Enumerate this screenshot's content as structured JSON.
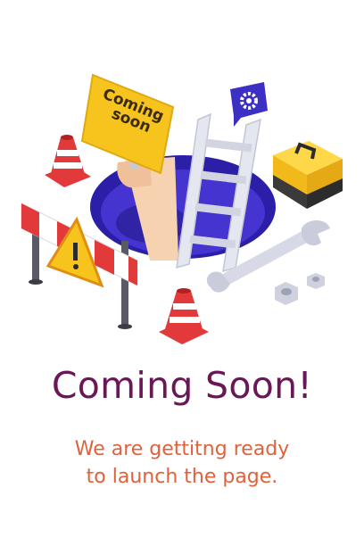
{
  "illustration": {
    "sign_text": [
      "Coming",
      "soon"
    ],
    "icons": [
      "traffic-cone-icon",
      "barrier-icon",
      "warning-sign-icon",
      "ladder-icon",
      "toolbox-icon",
      "wrench-icon",
      "nut-icon",
      "gear-chat-icon",
      "hole-icon",
      "hand-icon"
    ],
    "colors": {
      "hole": "#2b1fa8",
      "hole_inner": "#4534d0",
      "sign": "#f7c41d",
      "cone": "#e23a3a",
      "barrier": "#e23a3a",
      "toolbox": "#f7c41d",
      "chat_bubble": "#3b2fc4",
      "metal": "#d7dae6",
      "skin": "#f6d2b0"
    }
  },
  "title": "Coming Soon!",
  "subtitle": [
    "We are gettitng ready",
    "to launch the page."
  ],
  "colors": {
    "title": "#6b1657",
    "subtitle": "#e0623d"
  }
}
